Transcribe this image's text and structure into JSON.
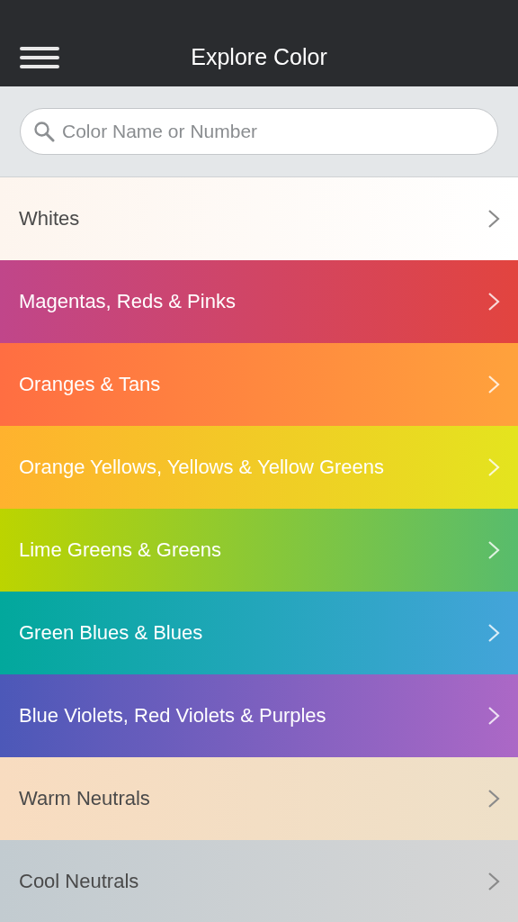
{
  "header": {
    "title": "Explore Color"
  },
  "search": {
    "placeholder": "Color Name or Number"
  },
  "categories": [
    {
      "label": "Whites",
      "kind": "pale",
      "gradient": [
        {
          "color": "#fdf5ee"
        },
        {
          "color": "#ffffff"
        }
      ]
    },
    {
      "label": "Magentas, Reds & Pinks",
      "kind": "vivid",
      "gradient": [
        {
          "color": "#c0468a"
        },
        {
          "color": "#e2443f"
        }
      ]
    },
    {
      "label": "Oranges & Tans",
      "kind": "vivid",
      "gradient": [
        {
          "color": "#ff6e42"
        },
        {
          "color": "#ffa23c"
        }
      ]
    },
    {
      "label": "Orange Yellows, Yellows & Yellow Greens",
      "kind": "vivid",
      "gradient": [
        {
          "color": "#ffb22e"
        },
        {
          "color": "#e4e41e"
        }
      ]
    },
    {
      "label": "Lime Greens & Greens",
      "kind": "vivid",
      "gradient": [
        {
          "color": "#bcd400"
        },
        {
          "color": "#58bc6c"
        }
      ]
    },
    {
      "label": "Green Blues & Blues",
      "kind": "vivid",
      "gradient": [
        {
          "color": "#02a89c"
        },
        {
          "color": "#44a4da"
        }
      ]
    },
    {
      "label": "Blue Violets, Red Violets & Purples",
      "kind": "vivid",
      "gradient": [
        {
          "color": "#4c58b8"
        },
        {
          "color": "#ac68c6"
        }
      ]
    },
    {
      "label": "Warm Neutrals",
      "kind": "pale",
      "gradient": [
        {
          "color": "#f8dcc0"
        },
        {
          "color": "#eee0c8"
        }
      ]
    },
    {
      "label": "Cool Neutrals",
      "kind": "pale",
      "gradient": [
        {
          "color": "#c2cbd0"
        },
        {
          "color": "#d6d6d6"
        }
      ]
    }
  ]
}
